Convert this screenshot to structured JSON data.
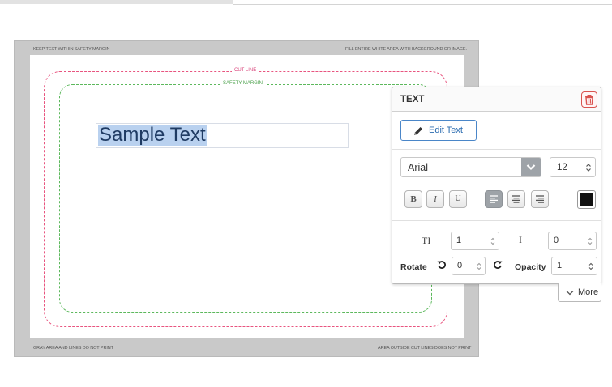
{
  "canvas": {
    "note_top_left": "KEEP TEXT WITHIN SAFETY MARGIN",
    "note_top_right": "FILL ENTIRE WHITE AREA WITH BACKGROUND OR IMAGE.",
    "note_bottom_left": "GRAY AREA AND LINES DO NOT PRINT",
    "note_bottom_right": "AREA OUTSIDE CUT LINES DOES NOT PRINT",
    "cut_line_label": "CUT LINE",
    "safety_margin_label": "SAFETY MARGIN",
    "cut_line_color": "#e8547f",
    "safety_margin_color": "#5cb85c",
    "sample_text": "Sample Text"
  },
  "panel": {
    "title": "TEXT",
    "delete_icon": "trash-icon",
    "edit_text_label": "Edit Text",
    "edit_icon": "pencil-icon",
    "font_family": "Arial",
    "font_size": "12",
    "format_buttons": {
      "bold": "B",
      "italic": "I",
      "underline": "U"
    },
    "alignment_selected": "left",
    "text_color": "#111111",
    "tracking_label": "TI",
    "tracking_value": "1",
    "leading_label": "I",
    "leading_value": "0",
    "rotate_label": "Rotate",
    "rotate_value": "0",
    "opacity_label": "Opacity",
    "opacity_value": "1",
    "more_label": "More"
  }
}
